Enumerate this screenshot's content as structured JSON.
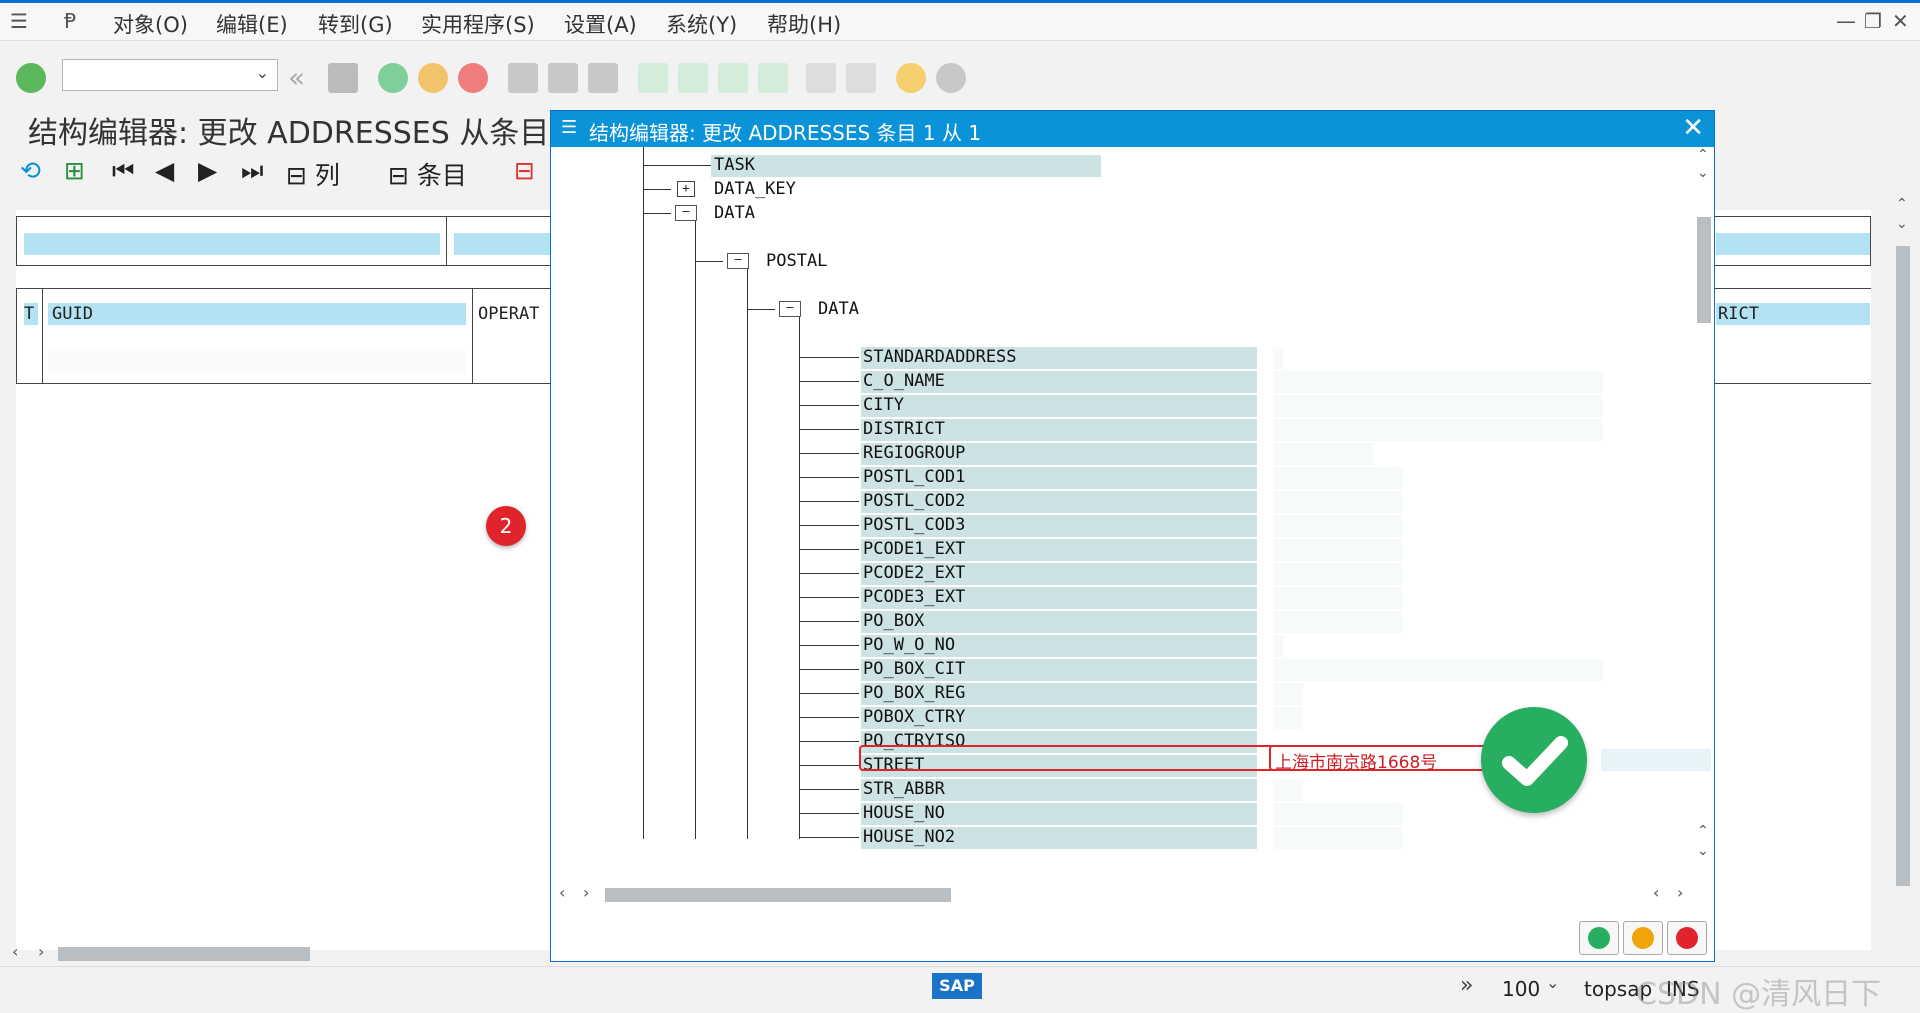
{
  "menubar": {
    "items": [
      "对象(O)",
      "编辑(E)",
      "转到(G)",
      "实用程序(S)",
      "设置(A)",
      "系统(Y)",
      "帮助(H)"
    ]
  },
  "page": {
    "title": "结构编辑器: 更改 ADDRESSES 从条目"
  },
  "app_toolbar": {
    "columns_label": "列",
    "entries_label": "条目"
  },
  "main_table": {
    "headers": {
      "t": "T",
      "guid": "GUID",
      "operat": "OPERAT",
      "rict": "RICT"
    }
  },
  "badge": {
    "number": "2"
  },
  "dialog": {
    "title": "结构编辑器: 更改 ADDRESSES 条目 1 从 1",
    "close": "✕",
    "tree": {
      "task": "TASK",
      "data_key": "DATA_KEY",
      "data": "DATA",
      "postal": "POSTAL",
      "postal_data": "DATA",
      "fields": [
        "STANDARDADDRESS",
        "C_O_NAME",
        "CITY",
        "DISTRICT",
        "REGIOGROUP",
        "POSTL_COD1",
        "POSTL_COD2",
        "POSTL_COD3",
        "PCODE1_EXT",
        "PCODE2_EXT",
        "PCODE3_EXT",
        "PO_BOX",
        "PO_W_O_NO",
        "PO_BOX_CIT",
        "PO_BOX_REG",
        "POBOX_CTRY",
        "PO_CTRYISO",
        "STREET",
        "STR_ABBR",
        "HOUSE_NO",
        "HOUSE_NO2"
      ],
      "street_value": "上海市南京路1668号"
    }
  },
  "statusbar": {
    "zoom": "100",
    "system": "topsap",
    "mode": "INS",
    "watermark": "CSDN @清风日下"
  },
  "colors": {
    "accent": "#0a93d8",
    "ok_green": "#27ae60",
    "highlight_red": "#e0242b"
  }
}
